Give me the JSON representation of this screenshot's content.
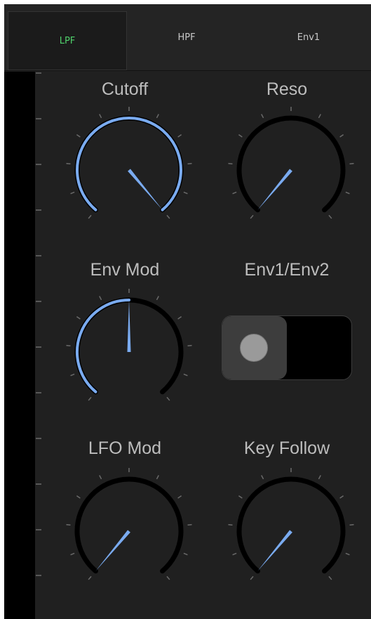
{
  "tabs": [
    {
      "label": "LPF",
      "active": true
    },
    {
      "label": "HPF",
      "active": false
    },
    {
      "label": "Env1",
      "active": false
    }
  ],
  "controls": {
    "cutoff": {
      "label": "Cutoff",
      "value": 1.0
    },
    "reso": {
      "label": "Reso",
      "value": 0.0
    },
    "env_mod": {
      "label": "Env Mod",
      "value": 0.5
    },
    "env_switch": {
      "label": "Env1/Env2",
      "state": "Env1"
    },
    "lfo_mod": {
      "label": "LFO Mod",
      "value": 0.0
    },
    "key_follow": {
      "label": "Key Follow",
      "value": 0.0
    }
  },
  "colors": {
    "accent": "#7aabf0",
    "active_tab_text": "#4fd06b",
    "label": "#bdbdbd",
    "background": "#202020"
  }
}
